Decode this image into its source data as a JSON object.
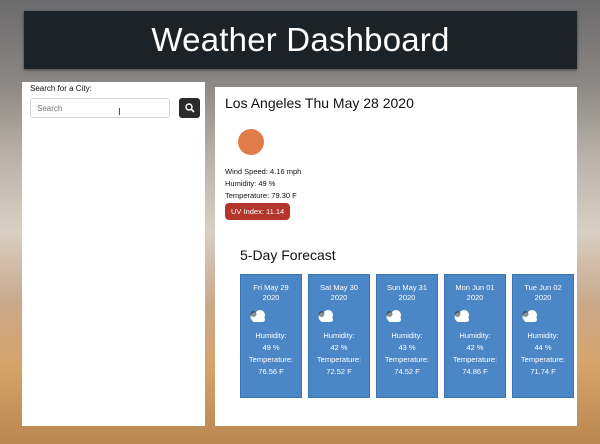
{
  "header": {
    "title": "Weather Dashboard"
  },
  "search": {
    "label": "Search for a City:",
    "placeholder": "Search",
    "button_icon": "search-icon"
  },
  "current": {
    "title": "Los Angeles Thu May 28 2020",
    "icon": "sun-icon",
    "wind": "Wind Speed: 4.16 mph",
    "humidity": "Humidity: 49 %",
    "temperature": "Temperature: 79.30 F",
    "uv": "UV Index: 11.14",
    "uv_color": "#b4352c"
  },
  "forecast": {
    "title": "5-Day Forecast",
    "card_color": "#4b87c6",
    "humidity_label": "Humidity:",
    "temperature_label": "Temperature:",
    "days": [
      {
        "date": "Fri May 29 2020",
        "icon": "cloud-icon",
        "humidity": "49 %",
        "temperature": "76.56 F"
      },
      {
        "date": "Sat May 30 2020",
        "icon": "cloud-icon",
        "humidity": "42 %",
        "temperature": "72.52 F"
      },
      {
        "date": "Sun May 31 2020",
        "icon": "cloud-icon",
        "humidity": "43 %",
        "temperature": "74.52 F"
      },
      {
        "date": "Mon Jun 01 2020",
        "icon": "cloud-icon",
        "humidity": "42 %",
        "temperature": "74.86 F"
      },
      {
        "date": "Tue Jun 02 2020",
        "icon": "cloud-icon",
        "humidity": "44 %",
        "temperature": "71.74 F"
      }
    ]
  }
}
